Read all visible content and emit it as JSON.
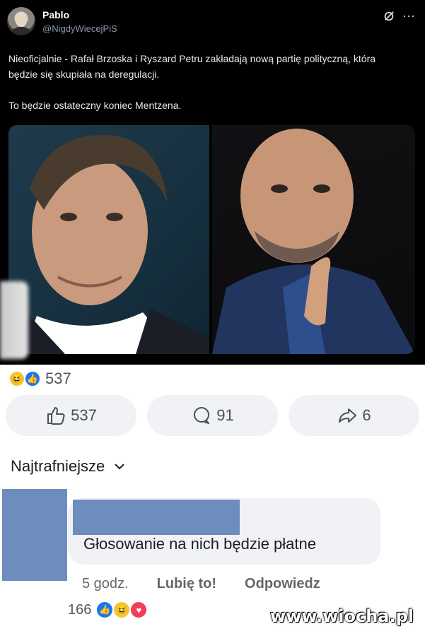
{
  "tweet": {
    "display_name": "Pablo",
    "handle": "@NigdyWiecejPiS",
    "text_p1": "Nieoficjalnie - Rafał Brzoska i Ryszard Petru zakładają nową partię polityczną, która będzie się skupiała na deregulacji.",
    "text_p2": "To będzie ostateczny koniec Mentzena.",
    "more_label": "···"
  },
  "post": {
    "reaction_count": "537",
    "actions": {
      "like_count": "537",
      "comment_count": "91",
      "share_count": "6"
    }
  },
  "comments": {
    "sort_label": "Najtrafniejsze",
    "items": [
      {
        "text": "Głosowanie na nich będzie płatne",
        "time": "5 godz.",
        "like_label": "Lubię to!",
        "reply_label": "Odpowiedz",
        "reaction_count": "166"
      }
    ]
  },
  "watermark": "www.wiocha.pl",
  "colors": {
    "facebook_blue": "#1877f2",
    "haha_yellow": "#f7c42c",
    "love_red": "#f33e58",
    "redaction": "#6d8dbf"
  }
}
